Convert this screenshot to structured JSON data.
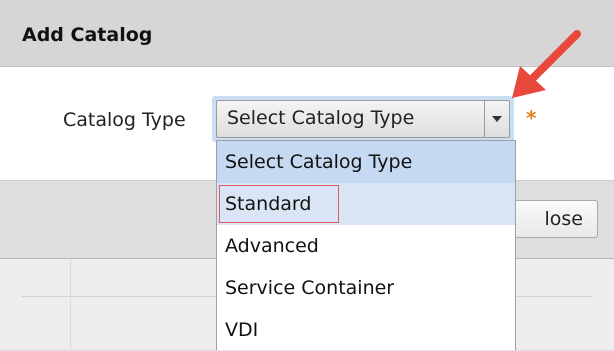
{
  "dialog": {
    "title": "Add Catalog",
    "field_label": "Catalog Type",
    "select": {
      "selected_value": "Select Catalog Type",
      "required_marker": "*"
    },
    "close_label": "lose"
  },
  "dropdown": {
    "options": [
      {
        "label": "Select Catalog Type",
        "state": "selected"
      },
      {
        "label": "Standard",
        "state": "hovered-outlined"
      },
      {
        "label": "Advanced",
        "state": "normal"
      },
      {
        "label": "Service Container",
        "state": "normal"
      },
      {
        "label": "VDI",
        "state": "normal"
      }
    ]
  },
  "annotation": {
    "arrow_color": "#e8473c",
    "outline_color": "#e05a63"
  },
  "icons": {
    "dropdown_caret": "chevron-down-icon",
    "callout_arrow": "arrow-icon"
  }
}
